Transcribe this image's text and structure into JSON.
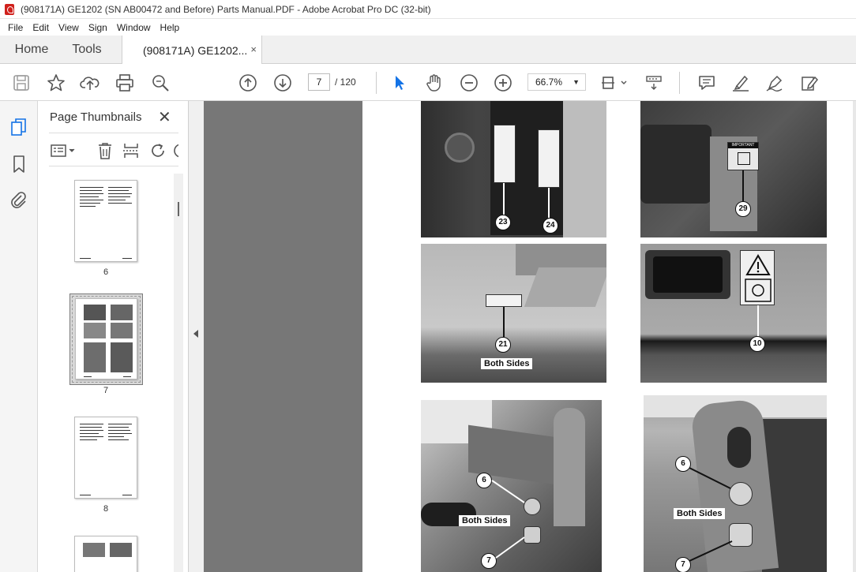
{
  "window": {
    "title": "(908171A) GE1202 (SN AB00472 and Before) Parts Manual.PDF - Adobe Acrobat Pro DC (32-bit)"
  },
  "menu": [
    "File",
    "Edit",
    "View",
    "Sign",
    "Window",
    "Help"
  ],
  "tabs": {
    "home": "Home",
    "tools": "Tools",
    "document": "(908171A) GE1202...",
    "close_glyph": "×"
  },
  "toolbar": {
    "icons": [
      "save-icon",
      "star-icon",
      "upload-icon",
      "print-icon",
      "search-zoom-icon",
      "page-up-icon",
      "page-down-icon",
      "select-arrow-icon",
      "hand-icon",
      "zoom-out-icon",
      "zoom-in-icon",
      "fit-page-icon",
      "scroll-mode-icon",
      "comment-icon",
      "highlight-icon",
      "draw-icon",
      "fill-sign-icon"
    ],
    "current_page": "7",
    "page_total": "/ 120",
    "zoom": "66.7%"
  },
  "left_rail": {
    "icons": [
      "page-thumbnails-icon",
      "bookmark-icon",
      "attachment-icon"
    ]
  },
  "thumbnail_panel": {
    "title": "Page Thumbnails",
    "close_glyph": "✕",
    "tools": [
      "options-menu-icon",
      "delete-icon",
      "insert-page-icon",
      "rotate-icon"
    ],
    "pages": [
      {
        "label": "6",
        "type": "text"
      },
      {
        "label": "7",
        "type": "photos",
        "selected": true
      },
      {
        "label": "8",
        "type": "text"
      },
      {
        "label": "",
        "type": "photos"
      }
    ]
  },
  "document": {
    "callouts": [
      "23",
      "24",
      "29",
      "21",
      "10",
      "6",
      "7",
      "6",
      "7"
    ],
    "tags": [
      "Both Sides",
      "Both Sides",
      "Both Sides"
    ],
    "decal_texts": [
      "IMPORTANT"
    ]
  },
  "colors": {
    "accent_blue": "#1473e6",
    "doc_background": "#777777",
    "acrobat_red": "#d0211c"
  }
}
